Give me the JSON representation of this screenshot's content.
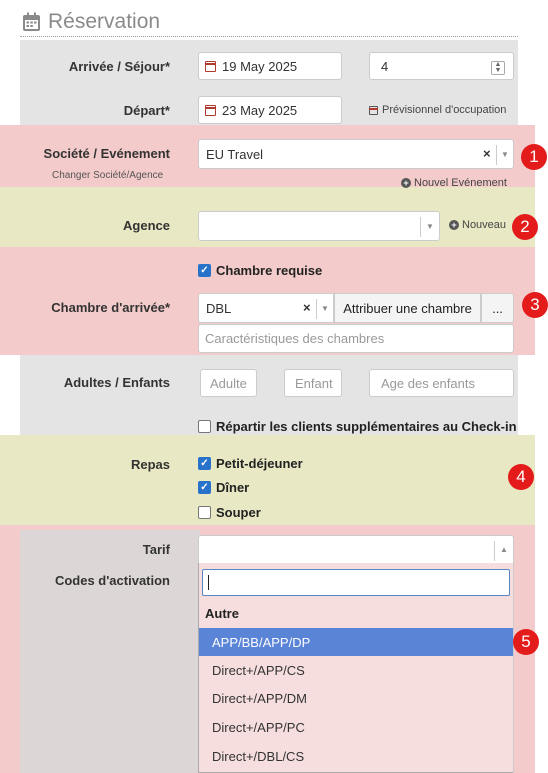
{
  "header": {
    "title": "Réservation",
    "icon": "calendar-icon"
  },
  "arrival": {
    "label": "Arrivée / Séjour*",
    "date": "19 May 2025",
    "nights": "4"
  },
  "departure": {
    "label": "Départ*",
    "date": "23 May 2025",
    "occupancy_link": "Prévisionnel d'occupation"
  },
  "company": {
    "label": "Société / Evénement",
    "sublabel": "Changer Société/Agence",
    "value": "EU Travel",
    "clear": "×",
    "new_event": "Nouvel Evénement"
  },
  "agency": {
    "label": "Agence",
    "value": "",
    "new_link": "Nouveau"
  },
  "room": {
    "required_label": "Chambre requise",
    "required_checked": true,
    "label": "Chambre d'arrivée*",
    "value": "DBL",
    "clear": "×",
    "assign_button": "Attribuer une chambre",
    "more_button": "...",
    "features_placeholder": "Caractéristiques des chambres"
  },
  "guests": {
    "label": "Adultes / Enfants",
    "adults_placeholder": "Adulte",
    "children_placeholder": "Enfant",
    "ages_placeholder": "Age des enfants",
    "distribute_label": "Répartir les clients supplémentaires au Check-in",
    "distribute_checked": false
  },
  "meals": {
    "label": "Repas",
    "options": [
      {
        "label": "Petit-déjeuner",
        "checked": true
      },
      {
        "label": "Dîner",
        "checked": true
      },
      {
        "label": "Souper",
        "checked": false
      }
    ]
  },
  "rate": {
    "label": "Tarif",
    "value": ""
  },
  "activation_codes": {
    "label": "Codes d'activation"
  },
  "dropdown": {
    "search_value": "",
    "group": "Autre",
    "items": [
      "APP/BB/APP/DP",
      "Direct+/APP/CS",
      "Direct+/APP/DM",
      "Direct+/APP/PC",
      "Direct+/DBL/CS"
    ],
    "selected_index": 0
  },
  "badges": [
    "1",
    "2",
    "3",
    "4",
    "5"
  ],
  "colors": {
    "red_zone": "#f3cbca",
    "green_zone": "#e8e8c4",
    "badge": "#e31b1b",
    "selected_item": "#5a84d6",
    "checkbox": "#2872c9"
  }
}
